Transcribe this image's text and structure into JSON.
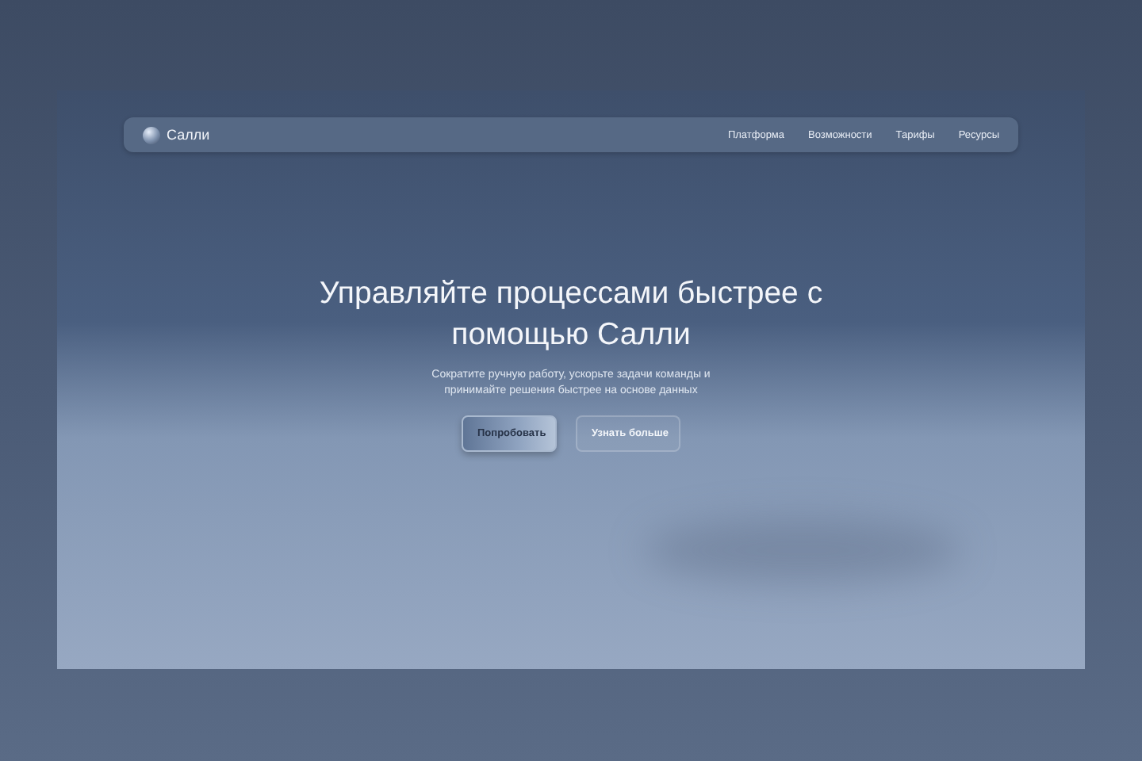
{
  "brand": {
    "name": "Салли"
  },
  "nav": [
    {
      "label": "Платформа"
    },
    {
      "label": "Возможности"
    },
    {
      "label": "Тарифы"
    },
    {
      "label": "Ресурсы"
    }
  ],
  "hero": {
    "title": "Управляйте процессами быстрее с помощью Салли",
    "subtitle": "Сократите ручную работу, ускорьте задачи команды и принимайте решения быстрее на основе данных",
    "buttons": [
      {
        "label": "Попробовать",
        "kind": "primary"
      },
      {
        "label": "Узнать больше",
        "kind": "secondary"
      }
    ]
  }
}
